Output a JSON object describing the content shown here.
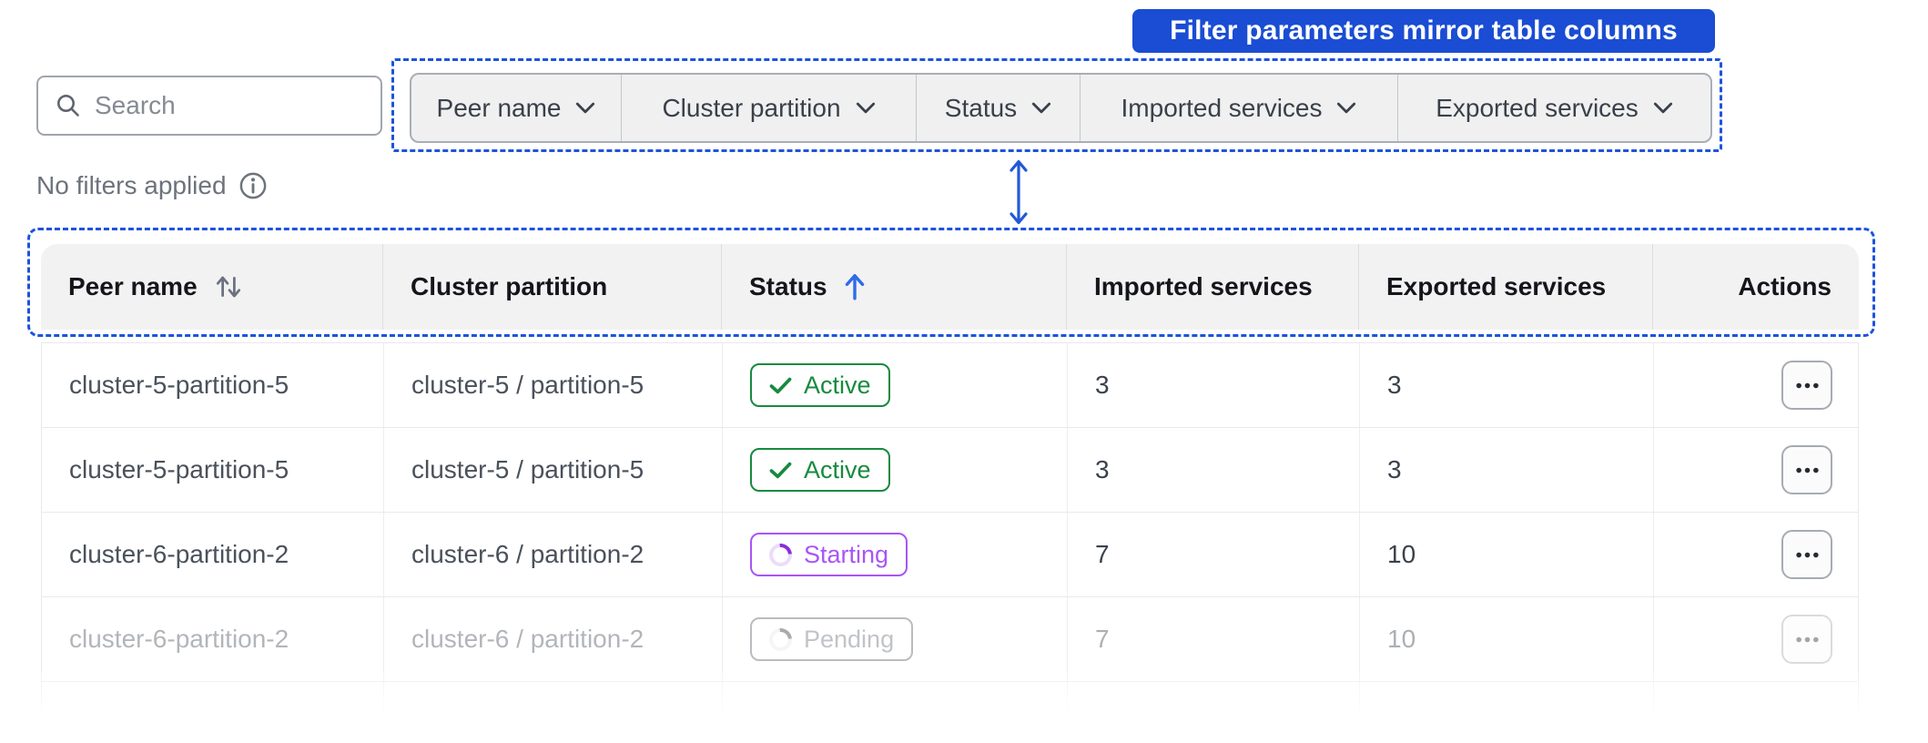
{
  "callout": {
    "label": "Filter parameters mirror table columns"
  },
  "search": {
    "placeholder": "Search"
  },
  "filters": {
    "items": [
      {
        "label": "Peer name"
      },
      {
        "label": "Cluster partition"
      },
      {
        "label": "Status"
      },
      {
        "label": "Imported services"
      },
      {
        "label": "Exported services"
      }
    ]
  },
  "filters_note": {
    "text": "No filters applied"
  },
  "table": {
    "columns": [
      {
        "label": "Peer name",
        "sort": "unsorted"
      },
      {
        "label": "Cluster partition",
        "sort": "none"
      },
      {
        "label": "Status",
        "sort": "ascending"
      },
      {
        "label": "Imported services",
        "sort": "none"
      },
      {
        "label": "Exported services",
        "sort": "none"
      },
      {
        "label": "Actions",
        "sort": "none"
      }
    ],
    "rows": [
      {
        "peer_name": "cluster-5-partition-5",
        "cluster_partition": "cluster-5 / partition-5",
        "status": "Active",
        "status_kind": "active",
        "imported": "3",
        "exported": "3",
        "faded": false
      },
      {
        "peer_name": "cluster-5-partition-5",
        "cluster_partition": "cluster-5 / partition-5",
        "status": "Active",
        "status_kind": "active",
        "imported": "3",
        "exported": "3",
        "faded": false
      },
      {
        "peer_name": "cluster-6-partition-2",
        "cluster_partition": "cluster-6 / partition-2",
        "status": "Starting",
        "status_kind": "starting",
        "imported": "7",
        "exported": "10",
        "faded": false
      },
      {
        "peer_name": "cluster-6-partition-2",
        "cluster_partition": "cluster-6 / partition-2",
        "status": "Pending",
        "status_kind": "pending",
        "imported": "7",
        "exported": "10",
        "faded": true
      }
    ]
  },
  "icons": {
    "search-icon": "⌕",
    "chevron-down-icon": "⌄",
    "info-icon": "ⓘ",
    "sort-unsorted-icon": "↑↓",
    "sort-ascending-icon": "↑",
    "check-icon": "✓",
    "spinner-icon": "◔",
    "ellipsis-icon": "•••",
    "double-arrow-icon": "↕"
  },
  "colors": {
    "accent_blue": "#1a4dd3",
    "dash_blue": "#1d53dc",
    "status_green": "#178a3e",
    "status_purple": "#a855f7",
    "status_gray": "#6b727c",
    "sort_arrow_blue": "#2f6bea"
  }
}
